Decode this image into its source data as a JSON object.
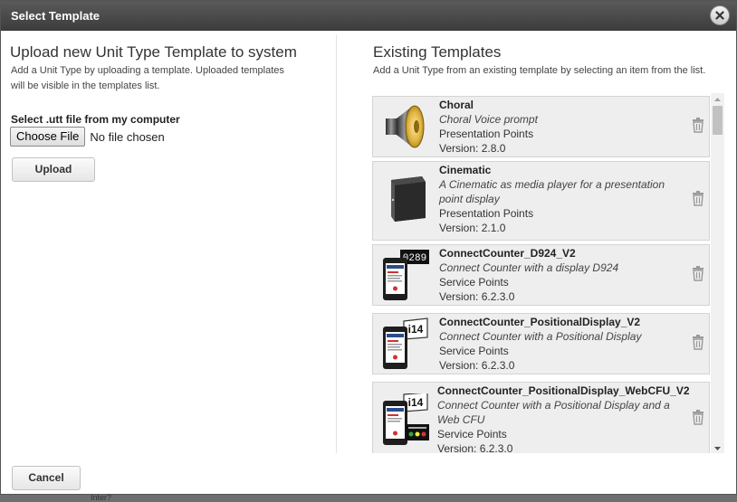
{
  "dialog": {
    "title": "Select Template"
  },
  "upload": {
    "heading": "Upload new Unit Type Template to system",
    "description": "Add a Unit Type by uploading a template. Uploaded templates will be visible in the templates list.",
    "file_label": "Select .utt file from my computer",
    "choose_file_label": "Choose File",
    "file_status": "No file chosen",
    "upload_label": "Upload"
  },
  "existing": {
    "heading": "Existing Templates",
    "description": "Add a Unit Type from an existing template by selecting an item from the list.",
    "items": [
      {
        "name": "Choral",
        "description": "Choral Voice prompt",
        "category": "Presentation Points",
        "version": "Version: 2.8.0",
        "icon": "speaker-icon"
      },
      {
        "name": "Cinematic",
        "description": "A Cinematic as media player for a presentation point display",
        "category": "Presentation Points",
        "version": "Version: 2.1.0",
        "icon": "media-player-icon"
      },
      {
        "name": "ConnectCounter_D924_V2",
        "description": "Connect Counter with a display D924",
        "category": "Service Points",
        "version": "Version: 6.2.3.0",
        "icon": "phone-display-icon",
        "display_text": "0289"
      },
      {
        "name": "ConnectCounter_PositionalDisplay_V2",
        "description": "Connect Counter with a Positional Display",
        "category": "Service Points",
        "version": "Version: 6.2.3.0",
        "icon": "phone-display-icon",
        "display_text": "i14"
      },
      {
        "name": "ConnectCounter_PositionalDisplay_WebCFU_V2",
        "description": "Connect Counter with a Positional Display and a Web CFU",
        "category": "Service Points",
        "version": "Version: 6.2.3.0",
        "icon": "phone-display-webcfu-icon",
        "display_text": "i14"
      }
    ]
  },
  "footer": {
    "cancel_label": "Cancel"
  },
  "background": {
    "partial_text": "Inter?"
  },
  "colors": {
    "titlebar": "#4a4a4a",
    "item_background": "#eeeeee",
    "item_border": "#d4d4d4"
  }
}
